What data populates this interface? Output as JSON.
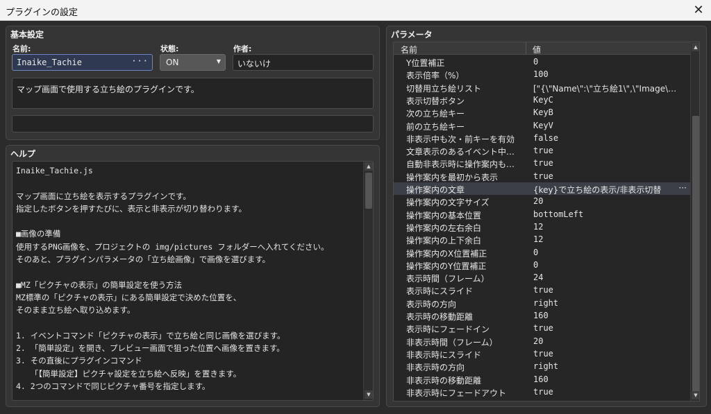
{
  "window": {
    "title": "プラグインの設定",
    "close_glyph": "✕"
  },
  "basic": {
    "title": "基本設定",
    "name_label": "名前:",
    "name_value": "Inaike_Tachie",
    "name_more": "···",
    "status_label": "状態:",
    "status_value": "ON",
    "status_arrow": "▼",
    "author_label": "作者:",
    "author_value": "いないけ",
    "description": "マップ画面で使用する立ち絵のプラグインです。",
    "extra": ""
  },
  "help": {
    "title": "ヘルプ",
    "lines": [
      "Inaike_Tachie.js",
      "",
      "マップ画面に立ち絵を表示するプラグインです。",
      "指定したボタンを押すたびに、表示と非表示が切り替わります。",
      "",
      "■画像の準備",
      "使用するPNG画像を、プロジェクトの img/pictures フォルダーへ入れてください。",
      "そのあと、プラグインパラメータの「立ち絵画像」で画像を選びます。",
      "",
      "■MZ「ピクチャの表示」の簡単設定を使う方法",
      "MZ標準の「ピクチャの表示」にある簡単設定で決めた位置を、",
      "そのまま立ち絵へ取り込めます。",
      "",
      "1. イベントコマンド「ピクチャの表示」で立ち絵と同じ画像を選びます。",
      "2. 「簡単設定」を開き、プレビュー画面で狙った位置へ画像を置きます。",
      "3. その直後にプラグインコマンド",
      "   「【簡単設定】ピクチャ設定を立ち絵へ反映」を置きます。",
      "4. 2つのコマンドで同じピクチャ番号を指定します。"
    ]
  },
  "params": {
    "title": "パラメータ",
    "col_name": "名前",
    "col_value": "値",
    "rows": [
      {
        "name": "Y位置補正",
        "value": "0"
      },
      {
        "name": "表示倍率（%）",
        "value": "100"
      },
      {
        "name": "切替用立ち絵リスト",
        "value": "[\"{\\\"Name\\\":\\\"立ち絵1\\\",\\\"Image\\…"
      },
      {
        "name": "表示切替ボタン",
        "value": "KeyC"
      },
      {
        "name": "次の立ち絵キー",
        "value": "KeyB"
      },
      {
        "name": "前の立ち絵キー",
        "value": "KeyV"
      },
      {
        "name": "非表示中も次・前キーを有効",
        "value": "false"
      },
      {
        "name": "文章表示のあるイベント中…",
        "value": "true"
      },
      {
        "name": "自動非表示時に操作案内も…",
        "value": "true"
      },
      {
        "name": "操作案内を最初から表示",
        "value": "true"
      },
      {
        "name": "操作案内の文章",
        "value": "{key}で立ち絵の表示/非表示切替",
        "more": "···"
      },
      {
        "name": "操作案内の文字サイズ",
        "value": "20"
      },
      {
        "name": "操作案内の基本位置",
        "value": "bottomLeft"
      },
      {
        "name": "操作案内の左右余白",
        "value": "12"
      },
      {
        "name": "操作案内の上下余白",
        "value": "12"
      },
      {
        "name": "操作案内のX位置補正",
        "value": "0"
      },
      {
        "name": "操作案内のY位置補正",
        "value": "0"
      },
      {
        "name": "表示時間（フレーム）",
        "value": "24"
      },
      {
        "name": "表示時にスライド",
        "value": "true"
      },
      {
        "name": "表示時の方向",
        "value": "right"
      },
      {
        "name": "表示時の移動距離",
        "value": "160"
      },
      {
        "name": "表示時にフェードイン",
        "value": "true"
      },
      {
        "name": "非表示時間（フレーム）",
        "value": "20"
      },
      {
        "name": "非表示時にスライド",
        "value": "true"
      },
      {
        "name": "非表示時の方向",
        "value": "right"
      },
      {
        "name": "非表示時の移動距離",
        "value": "160"
      },
      {
        "name": "非表示時にフェードアウト",
        "value": "true"
      }
    ]
  },
  "scroll": {
    "up": "▲",
    "down": "▼"
  }
}
